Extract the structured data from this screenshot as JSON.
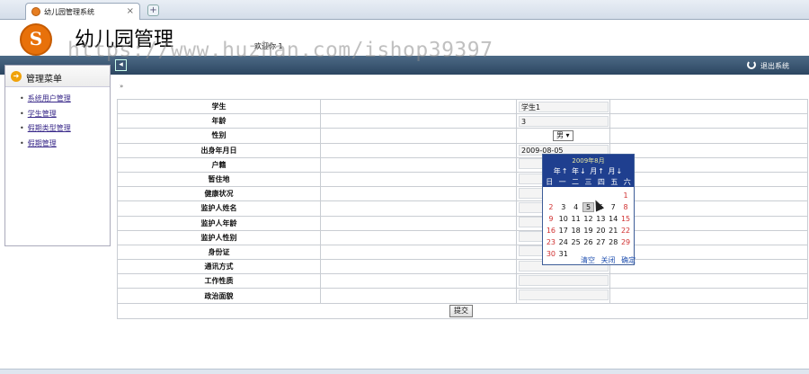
{
  "browser": {
    "tab_title": "幼儿园管理系统",
    "close": "×",
    "new_tab": "+"
  },
  "header": {
    "logo_letter": "S",
    "app_title": "幼儿园管理",
    "welcome": "欢迎你 1",
    "watermark": "https://www.huzhan.com/ishop39397"
  },
  "topbar": {
    "collapse": "◂",
    "logout": "退出系统"
  },
  "sidebar": {
    "title": "管理菜单",
    "items": [
      {
        "label": "系统用户管理"
      },
      {
        "label": "学生管理"
      },
      {
        "label": "假期类型管理"
      },
      {
        "label": "假期管理"
      }
    ]
  },
  "breadcrumb": "»",
  "form": {
    "rows": [
      {
        "label": "学生",
        "value": "学生1"
      },
      {
        "label": "年龄",
        "value": "3"
      },
      {
        "label": "性别",
        "value": "男 ▾"
      },
      {
        "label": "出身年月日",
        "value": "2009-08-05"
      },
      {
        "label": "户籍",
        "value": ""
      },
      {
        "label": "暂住地",
        "value": ""
      },
      {
        "label": "健康状况",
        "value": ""
      },
      {
        "label": "监护人姓名",
        "value": ""
      },
      {
        "label": "监护人年龄",
        "value": ""
      },
      {
        "label": "监护人性别",
        "value": ""
      },
      {
        "label": "身份证",
        "value": ""
      },
      {
        "label": "通讯方式",
        "value": ""
      },
      {
        "label": "工作性质",
        "value": ""
      },
      {
        "label": "政治面貌",
        "value": ""
      }
    ],
    "submit": "提交"
  },
  "calendar": {
    "title": "2009年8月",
    "nav": "年↑ 年↓ 月↑ 月↓",
    "weekdays": [
      "日",
      "一",
      "二",
      "三",
      "四",
      "五",
      "六"
    ],
    "days": [
      "",
      "",
      "",
      "",
      "",
      "",
      "1",
      "2",
      "3",
      "4",
      "5",
      "6",
      "7",
      "8",
      "9",
      "10",
      "11",
      "12",
      "13",
      "14",
      "15",
      "16",
      "17",
      "18",
      "19",
      "20",
      "21",
      "22",
      "23",
      "24",
      "25",
      "26",
      "27",
      "28",
      "29",
      "30",
      "31"
    ],
    "selected_day": "5",
    "clear": "清空",
    "close": "关闭",
    "confirm": "确定"
  }
}
